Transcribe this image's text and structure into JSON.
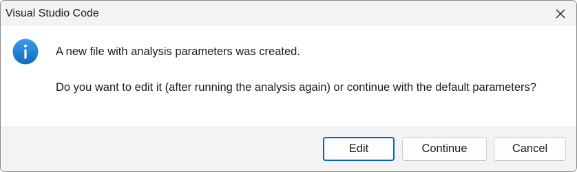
{
  "window": {
    "title": "Visual Studio Code",
    "close_icon": "close-icon"
  },
  "message": {
    "icon": "info-icon",
    "icon_color": "#0f6cbd",
    "main": "A new file with analysis parameters was created.",
    "detail": "Do you want to edit it (after running the analysis again) or continue with the default parameters?"
  },
  "buttons": {
    "edit": "Edit",
    "continue": "Continue",
    "cancel": "Cancel"
  },
  "colors": {
    "accent": "#0067c0",
    "titlebar_bg": "#f3f3f3",
    "footer_bg": "#f3f3f3"
  }
}
